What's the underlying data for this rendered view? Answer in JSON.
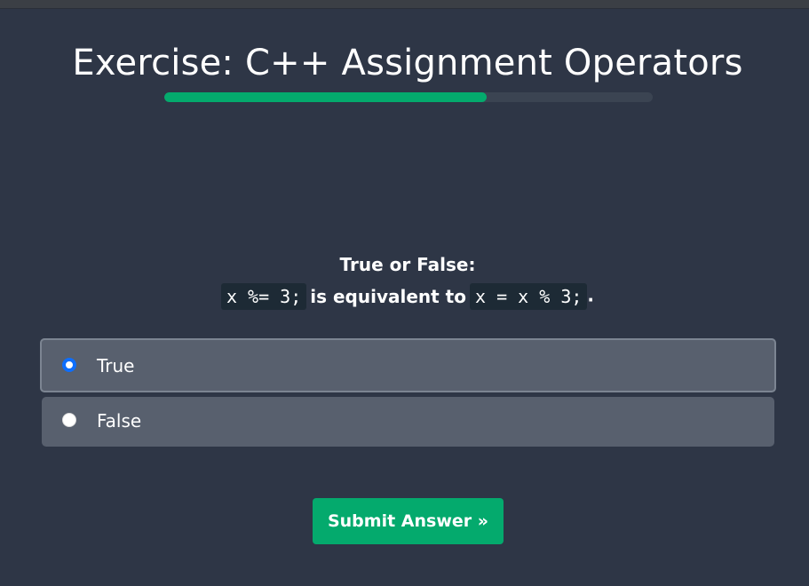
{
  "header": {
    "title": "Exercise: C++ Assignment Operators",
    "progress_fraction": 0.66
  },
  "question": {
    "heading": "True or False:",
    "code_left": "x %= 3;",
    "middle_text": "is equivalent to",
    "code_right": "x = x % 3;",
    "trailing": "."
  },
  "options": [
    {
      "label": "True",
      "selected": true
    },
    {
      "label": "False",
      "selected": false
    }
  ],
  "submit": {
    "label": "Submit Answer »"
  },
  "colors": {
    "background": "#2e3646",
    "accent": "#04aa6d",
    "option_bg": "#58606e",
    "code_bg": "#1d2a35",
    "radio_selected": "#0d6efd"
  }
}
